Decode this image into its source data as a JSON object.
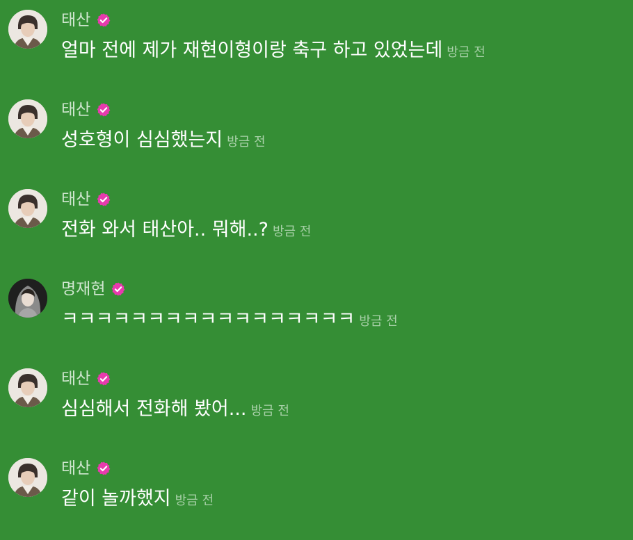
{
  "accent": {
    "background": "#358e35",
    "verified_badge": "#e83aae",
    "name_color": "#cfe6cf",
    "time_color": "#a9d1a9"
  },
  "messages": [
    {
      "author": "태산",
      "text": "얼마 전에 제가 재현이형이랑 축구 하고 있었는데",
      "time": "방금 전",
      "avatar": "avatar-taesan"
    },
    {
      "author": "태산",
      "text": "성호형이 심심했는지",
      "time": "방금 전",
      "avatar": "avatar-taesan"
    },
    {
      "author": "태산",
      "text": "전화 와서 태산아.. 뭐해..?",
      "time": "방금 전",
      "avatar": "avatar-taesan"
    },
    {
      "author": "명재현",
      "text": "ㅋㅋㅋㅋㅋㅋㅋㅋㅋㅋㅋㅋㅋㅋㅋㅋㅋ",
      "time": "방금 전",
      "avatar": "avatar-myungjaehyun"
    },
    {
      "author": "태산",
      "text": "심심해서 전화해 봤어...",
      "time": "방금 전",
      "avatar": "avatar-taesan"
    },
    {
      "author": "태산",
      "text": "같이 놀까했지",
      "time": "방금 전",
      "avatar": "avatar-taesan"
    }
  ]
}
